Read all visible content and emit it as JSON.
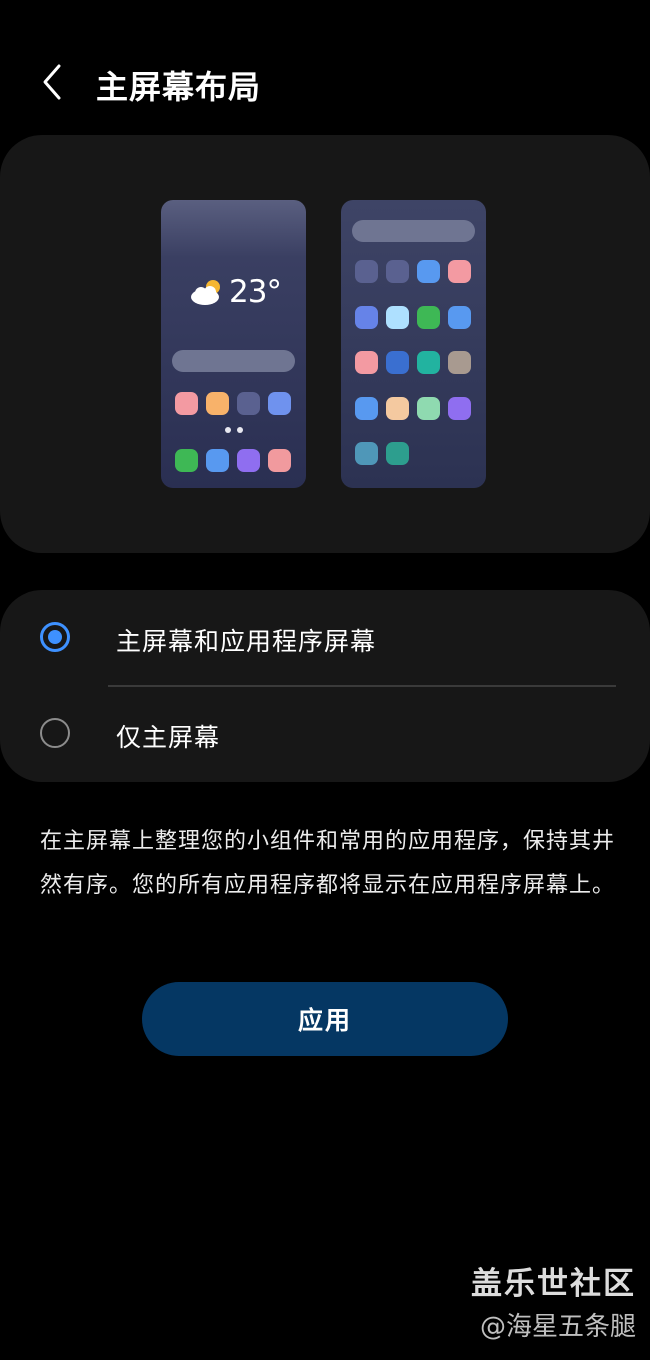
{
  "header": {
    "back_icon": "chevron-left-icon",
    "title": "主屏幕布局"
  },
  "preview": {
    "weather_icon": "partly-cloudy-icon",
    "temperature": "23°",
    "home_screen_apps": {
      "row1": [
        "#f39aa2",
        "#f8b26a",
        "#5a6190",
        "#6f92ee"
      ],
      "dock": [
        "#3eb855",
        "#5899f0",
        "#8f6ef0",
        "#f19a9e"
      ]
    },
    "app_screen_apps": [
      [
        "#5a6190",
        "#5a6190",
        "#5899f0",
        "#f39aa2"
      ],
      [
        "#6683e8",
        "#aee0ff",
        "#3eb855",
        "#5899f0"
      ],
      [
        "#f39aa2",
        "#3a6fd0",
        "#22b3a0",
        "#a89a90"
      ],
      [
        "#5899f0",
        "#f4c9a0",
        "#8fdab0",
        "#8f6ef0"
      ],
      [
        "#4f97b8",
        "#2d9e8e"
      ]
    ]
  },
  "options": [
    {
      "label": "主屏幕和应用程序屏幕",
      "selected": true
    },
    {
      "label": "仅主屏幕",
      "selected": false
    }
  ],
  "colors": {
    "accent": "#3e91ff",
    "apply_button": "#053763"
  },
  "description": "在主屏幕上整理您的小组件和常用的应用程序，保持其井然有序。您的所有应用程序都将显示在应用程序屏幕上。",
  "apply_label": "应用",
  "watermark": {
    "brand": "盖乐世社区",
    "author": "@海星五条腿"
  }
}
